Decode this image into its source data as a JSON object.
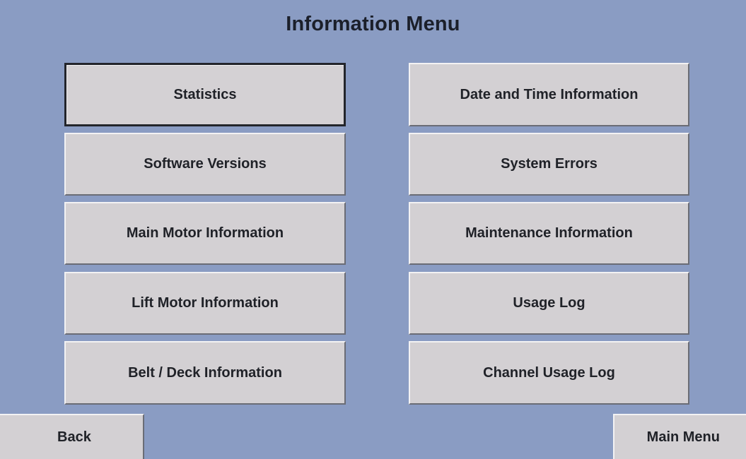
{
  "screen": {
    "title": "Information Menu"
  },
  "menu": {
    "left": [
      {
        "label": "Statistics"
      },
      {
        "label": "Software Versions"
      },
      {
        "label": "Main Motor Information"
      },
      {
        "label": "Lift Motor Information"
      },
      {
        "label": "Belt / Deck Information"
      }
    ],
    "right": [
      {
        "label": "Date and Time Information"
      },
      {
        "label": "System Errors"
      },
      {
        "label": "Maintenance Information"
      },
      {
        "label": "Usage Log"
      },
      {
        "label": "Channel Usage Log"
      }
    ],
    "selected": "Statistics"
  },
  "nav": {
    "back_label": "Back",
    "main_menu_label": "Main Menu"
  },
  "colors": {
    "background": "#8a9cc3",
    "button_face": "#d3d0d3",
    "text": "#202228"
  }
}
